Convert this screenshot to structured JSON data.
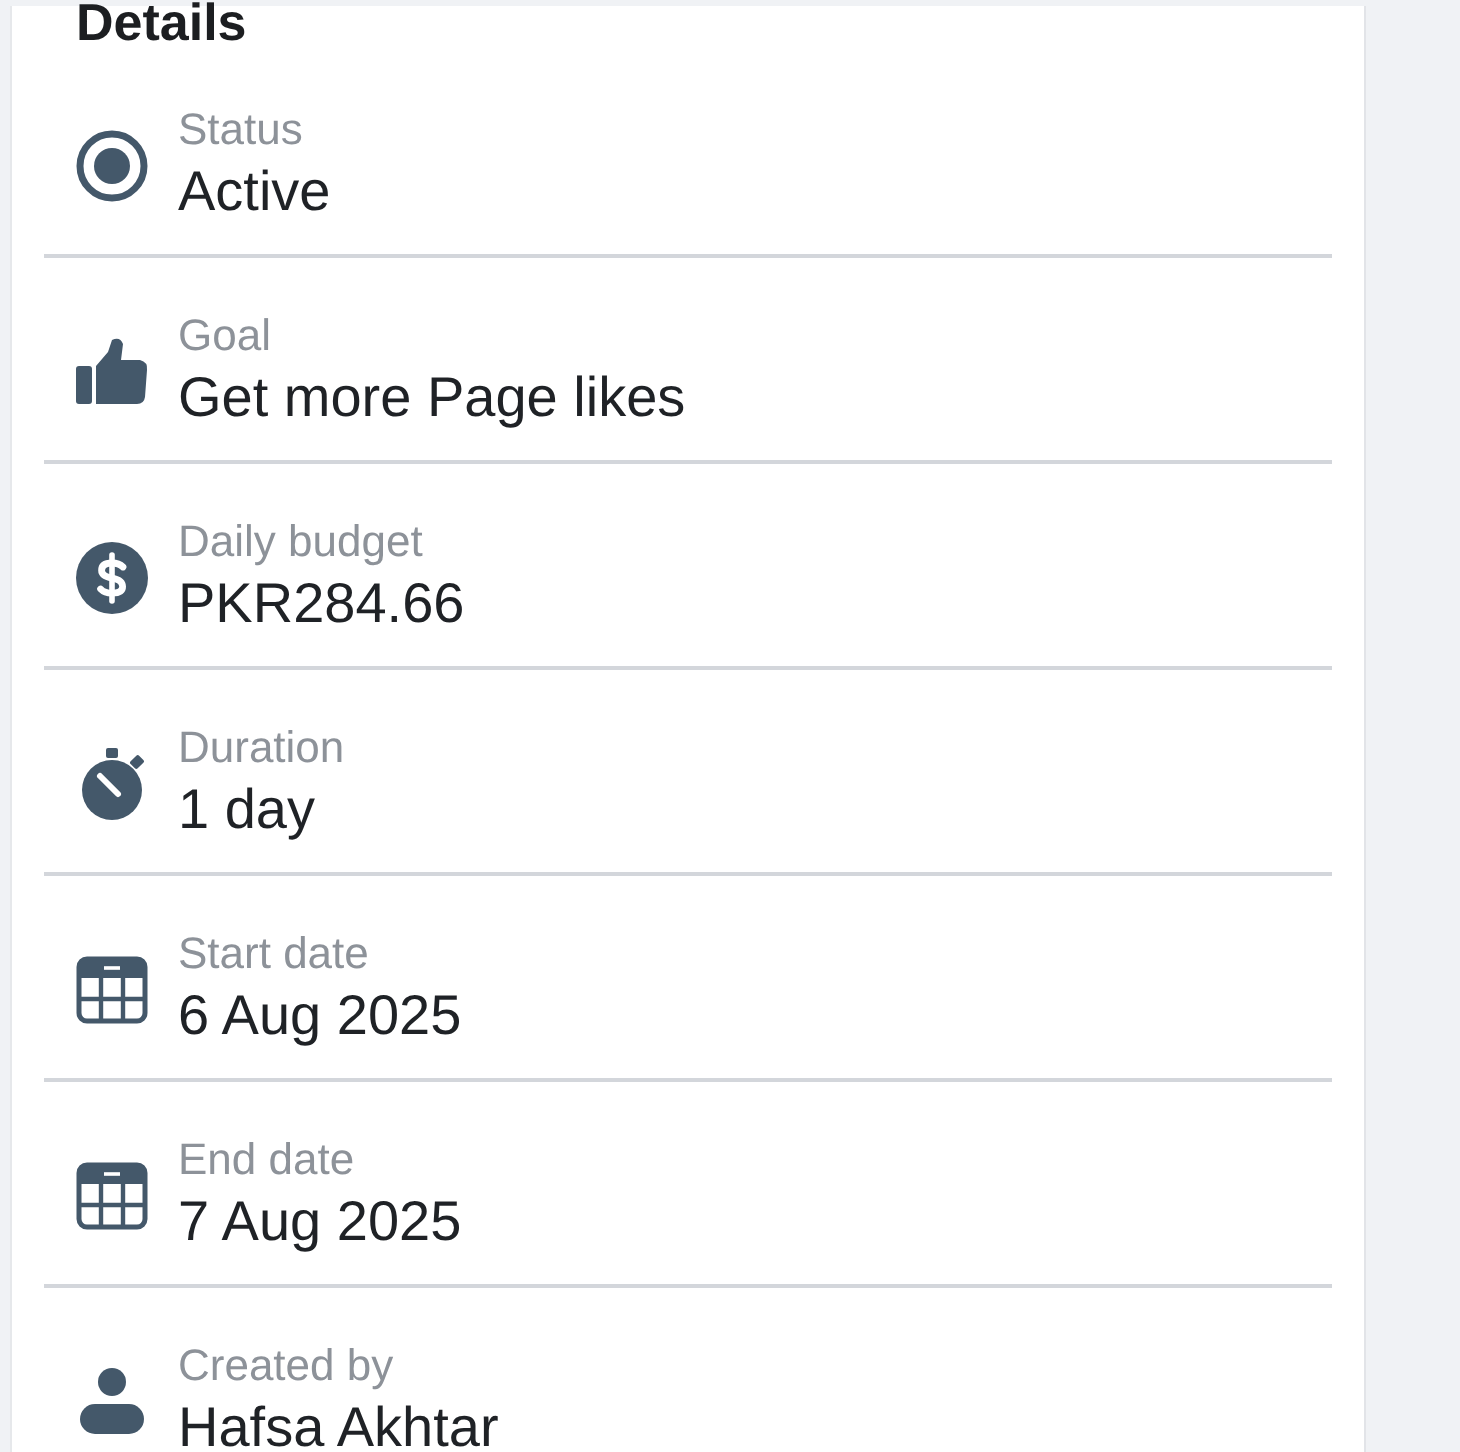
{
  "heading": "Details",
  "details": [
    {
      "kind": "status",
      "label": "Status",
      "value": "Active"
    },
    {
      "kind": "goal",
      "label": "Goal",
      "value": "Get more Page likes"
    },
    {
      "kind": "budget",
      "label": "Daily budget",
      "value": "PKR284.66"
    },
    {
      "kind": "duration",
      "label": "Duration",
      "value": "1 day"
    },
    {
      "kind": "date",
      "label": "Start date",
      "value": "6 Aug 2025"
    },
    {
      "kind": "date",
      "label": "End date",
      "value": "7 Aug 2025"
    },
    {
      "kind": "person",
      "label": "Created by",
      "value": "Hafsa Akhtar"
    }
  ]
}
